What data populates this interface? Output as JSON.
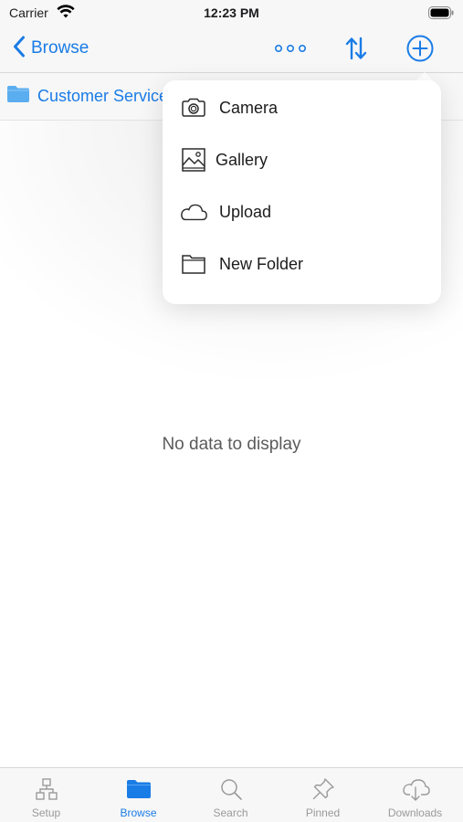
{
  "status_bar": {
    "carrier": "Carrier",
    "time": "12:23 PM"
  },
  "nav_bar": {
    "back_label": "Browse",
    "icons": [
      "more-icon",
      "sort-icon",
      "add-icon"
    ]
  },
  "breadcrumb": {
    "folder_label": "Customer Service"
  },
  "empty_state": {
    "message": "No data to display"
  },
  "add_menu": {
    "items": [
      {
        "label": "Camera",
        "icon": "camera-icon"
      },
      {
        "label": "Gallery",
        "icon": "gallery-icon"
      },
      {
        "label": "Upload",
        "icon": "cloud-upload-icon"
      },
      {
        "label": "New Folder",
        "icon": "folder-icon"
      }
    ]
  },
  "tab_bar": {
    "active_tab": "Browse",
    "tabs": [
      {
        "label": "Setup",
        "icon": "hierarchy-icon"
      },
      {
        "label": "Browse",
        "icon": "folder-icon"
      },
      {
        "label": "Search",
        "icon": "search-icon"
      },
      {
        "label": "Pinned",
        "icon": "pin-icon"
      },
      {
        "label": "Downloads",
        "icon": "cloud-download-icon"
      }
    ]
  },
  "colors": {
    "accent": "#1a7ce6",
    "inactive": "#9a9a9a",
    "folder": "#5aaef0"
  }
}
